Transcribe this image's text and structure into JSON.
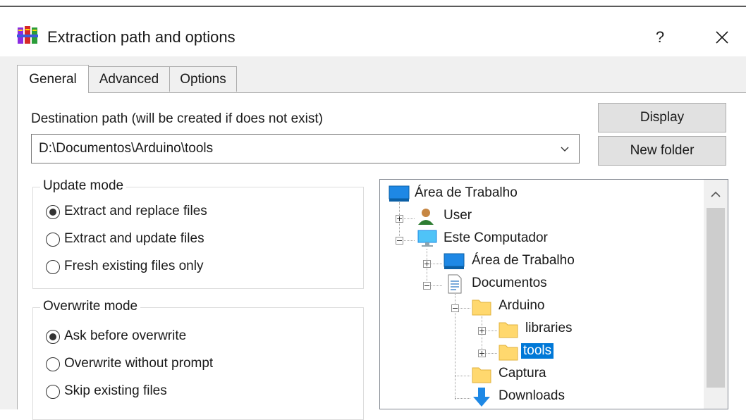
{
  "window": {
    "title": "Extraction path and options",
    "help_label": "?",
    "icon": "winrar-books-icon"
  },
  "tabs": [
    {
      "label": "General",
      "active": true
    },
    {
      "label": "Advanced",
      "active": false
    },
    {
      "label": "Options",
      "active": false
    }
  ],
  "destination": {
    "label": "Destination path (will be created if does not exist)",
    "value": "D:\\Documentos\\Arduino\\tools"
  },
  "buttons": {
    "display": "Display",
    "new_folder": "New folder"
  },
  "update_mode": {
    "title": "Update mode",
    "options": [
      {
        "label": "Extract and replace files",
        "checked": true
      },
      {
        "label": "Extract and update files",
        "checked": false
      },
      {
        "label": "Fresh existing files only",
        "checked": false
      }
    ]
  },
  "overwrite_mode": {
    "title": "Overwrite mode",
    "options": [
      {
        "label": "Ask before overwrite",
        "checked": true
      },
      {
        "label": "Overwrite without prompt",
        "checked": false
      },
      {
        "label": "Skip existing files",
        "checked": false
      }
    ]
  },
  "tree": {
    "items": [
      {
        "label": "Área de Trabalho",
        "icon": "desktop-icon",
        "selected": false
      },
      {
        "label": "User",
        "icon": "user-icon",
        "selected": false
      },
      {
        "label": "Este Computador",
        "icon": "computer-icon",
        "selected": false
      },
      {
        "label": "Área de Trabalho",
        "icon": "desktop-icon",
        "selected": false
      },
      {
        "label": "Documentos",
        "icon": "documents-icon",
        "selected": false
      },
      {
        "label": "Arduino",
        "icon": "folder-icon",
        "selected": false
      },
      {
        "label": "libraries",
        "icon": "folder-icon",
        "selected": false
      },
      {
        "label": "tools",
        "icon": "folder-icon",
        "selected": true
      },
      {
        "label": "Captura",
        "icon": "folder-icon",
        "selected": false
      },
      {
        "label": "Downloads",
        "icon": "downloads-icon",
        "selected": false
      }
    ]
  },
  "colors": {
    "selection": "#0078d7",
    "dialog_bg": "#f0f0f0",
    "folder": "#ffd86e"
  }
}
